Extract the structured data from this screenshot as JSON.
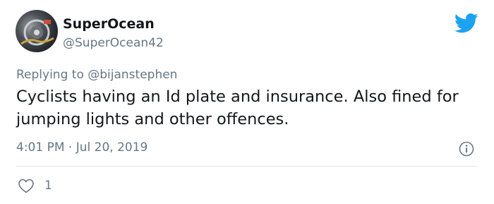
{
  "tweet": {
    "display_name": "SuperOcean",
    "handle": "@SuperOcean42",
    "replying_prefix": "Replying to ",
    "replying_to": "@bijanstephen",
    "text": "Cyclists having an Id plate and insurance. Also fined for jumping lights and other offences.",
    "timestamp": "4:01 PM · Jul 20, 2019",
    "like_count": "1"
  },
  "icons": {
    "brand": "twitter-bird-icon",
    "info": "info-icon",
    "like": "heart-icon"
  },
  "colors": {
    "brand_blue": "#1da1f2",
    "secondary_text": "#657786",
    "primary_text": "#14171a",
    "divider": "#e1e8ed"
  }
}
